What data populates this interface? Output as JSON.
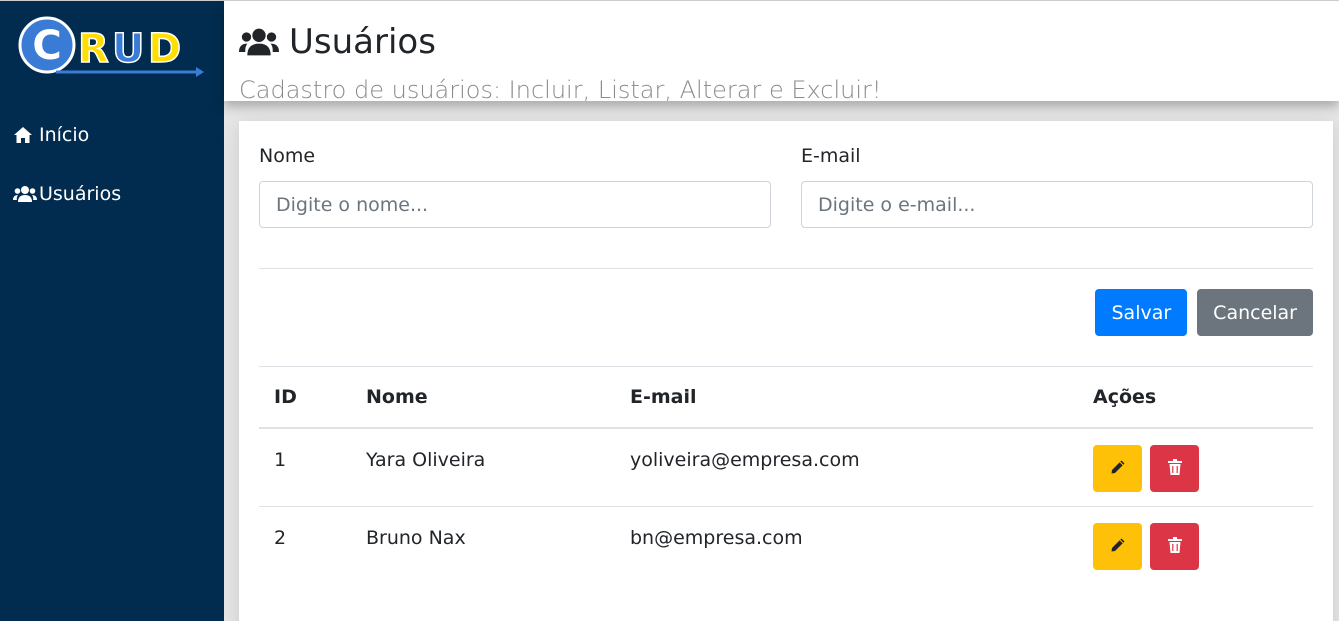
{
  "app": {
    "logo_text": "CRUD",
    "colors": {
      "sidebar": "#012c4f",
      "primary": "#007bff",
      "secondary": "#6c757d",
      "warning": "#ffc107",
      "danger": "#dc3545"
    }
  },
  "sidebar": {
    "items": [
      {
        "label": "Início",
        "icon": "home-icon"
      },
      {
        "label": "Usuários",
        "icon": "users-icon"
      }
    ]
  },
  "header": {
    "title": "Usuários",
    "title_icon": "users-icon",
    "subtitle": "Cadastro de usuários: Incluir, Listar, Alterar e Excluir!"
  },
  "form": {
    "name_label": "Nome",
    "name_placeholder": "Digite o nome...",
    "email_label": "E-mail",
    "email_placeholder": "Digite o e-mail...",
    "save_label": "Salvar",
    "cancel_label": "Cancelar"
  },
  "table": {
    "headers": [
      "ID",
      "Nome",
      "E-mail",
      "Ações"
    ],
    "rows": [
      {
        "id": "1",
        "name": "Yara Oliveira",
        "email": "yoliveira@empresa.com"
      },
      {
        "id": "2",
        "name": "Bruno Nax",
        "email": "bn@empresa.com"
      }
    ],
    "row_actions": [
      "pencil-icon",
      "trash-icon"
    ]
  }
}
